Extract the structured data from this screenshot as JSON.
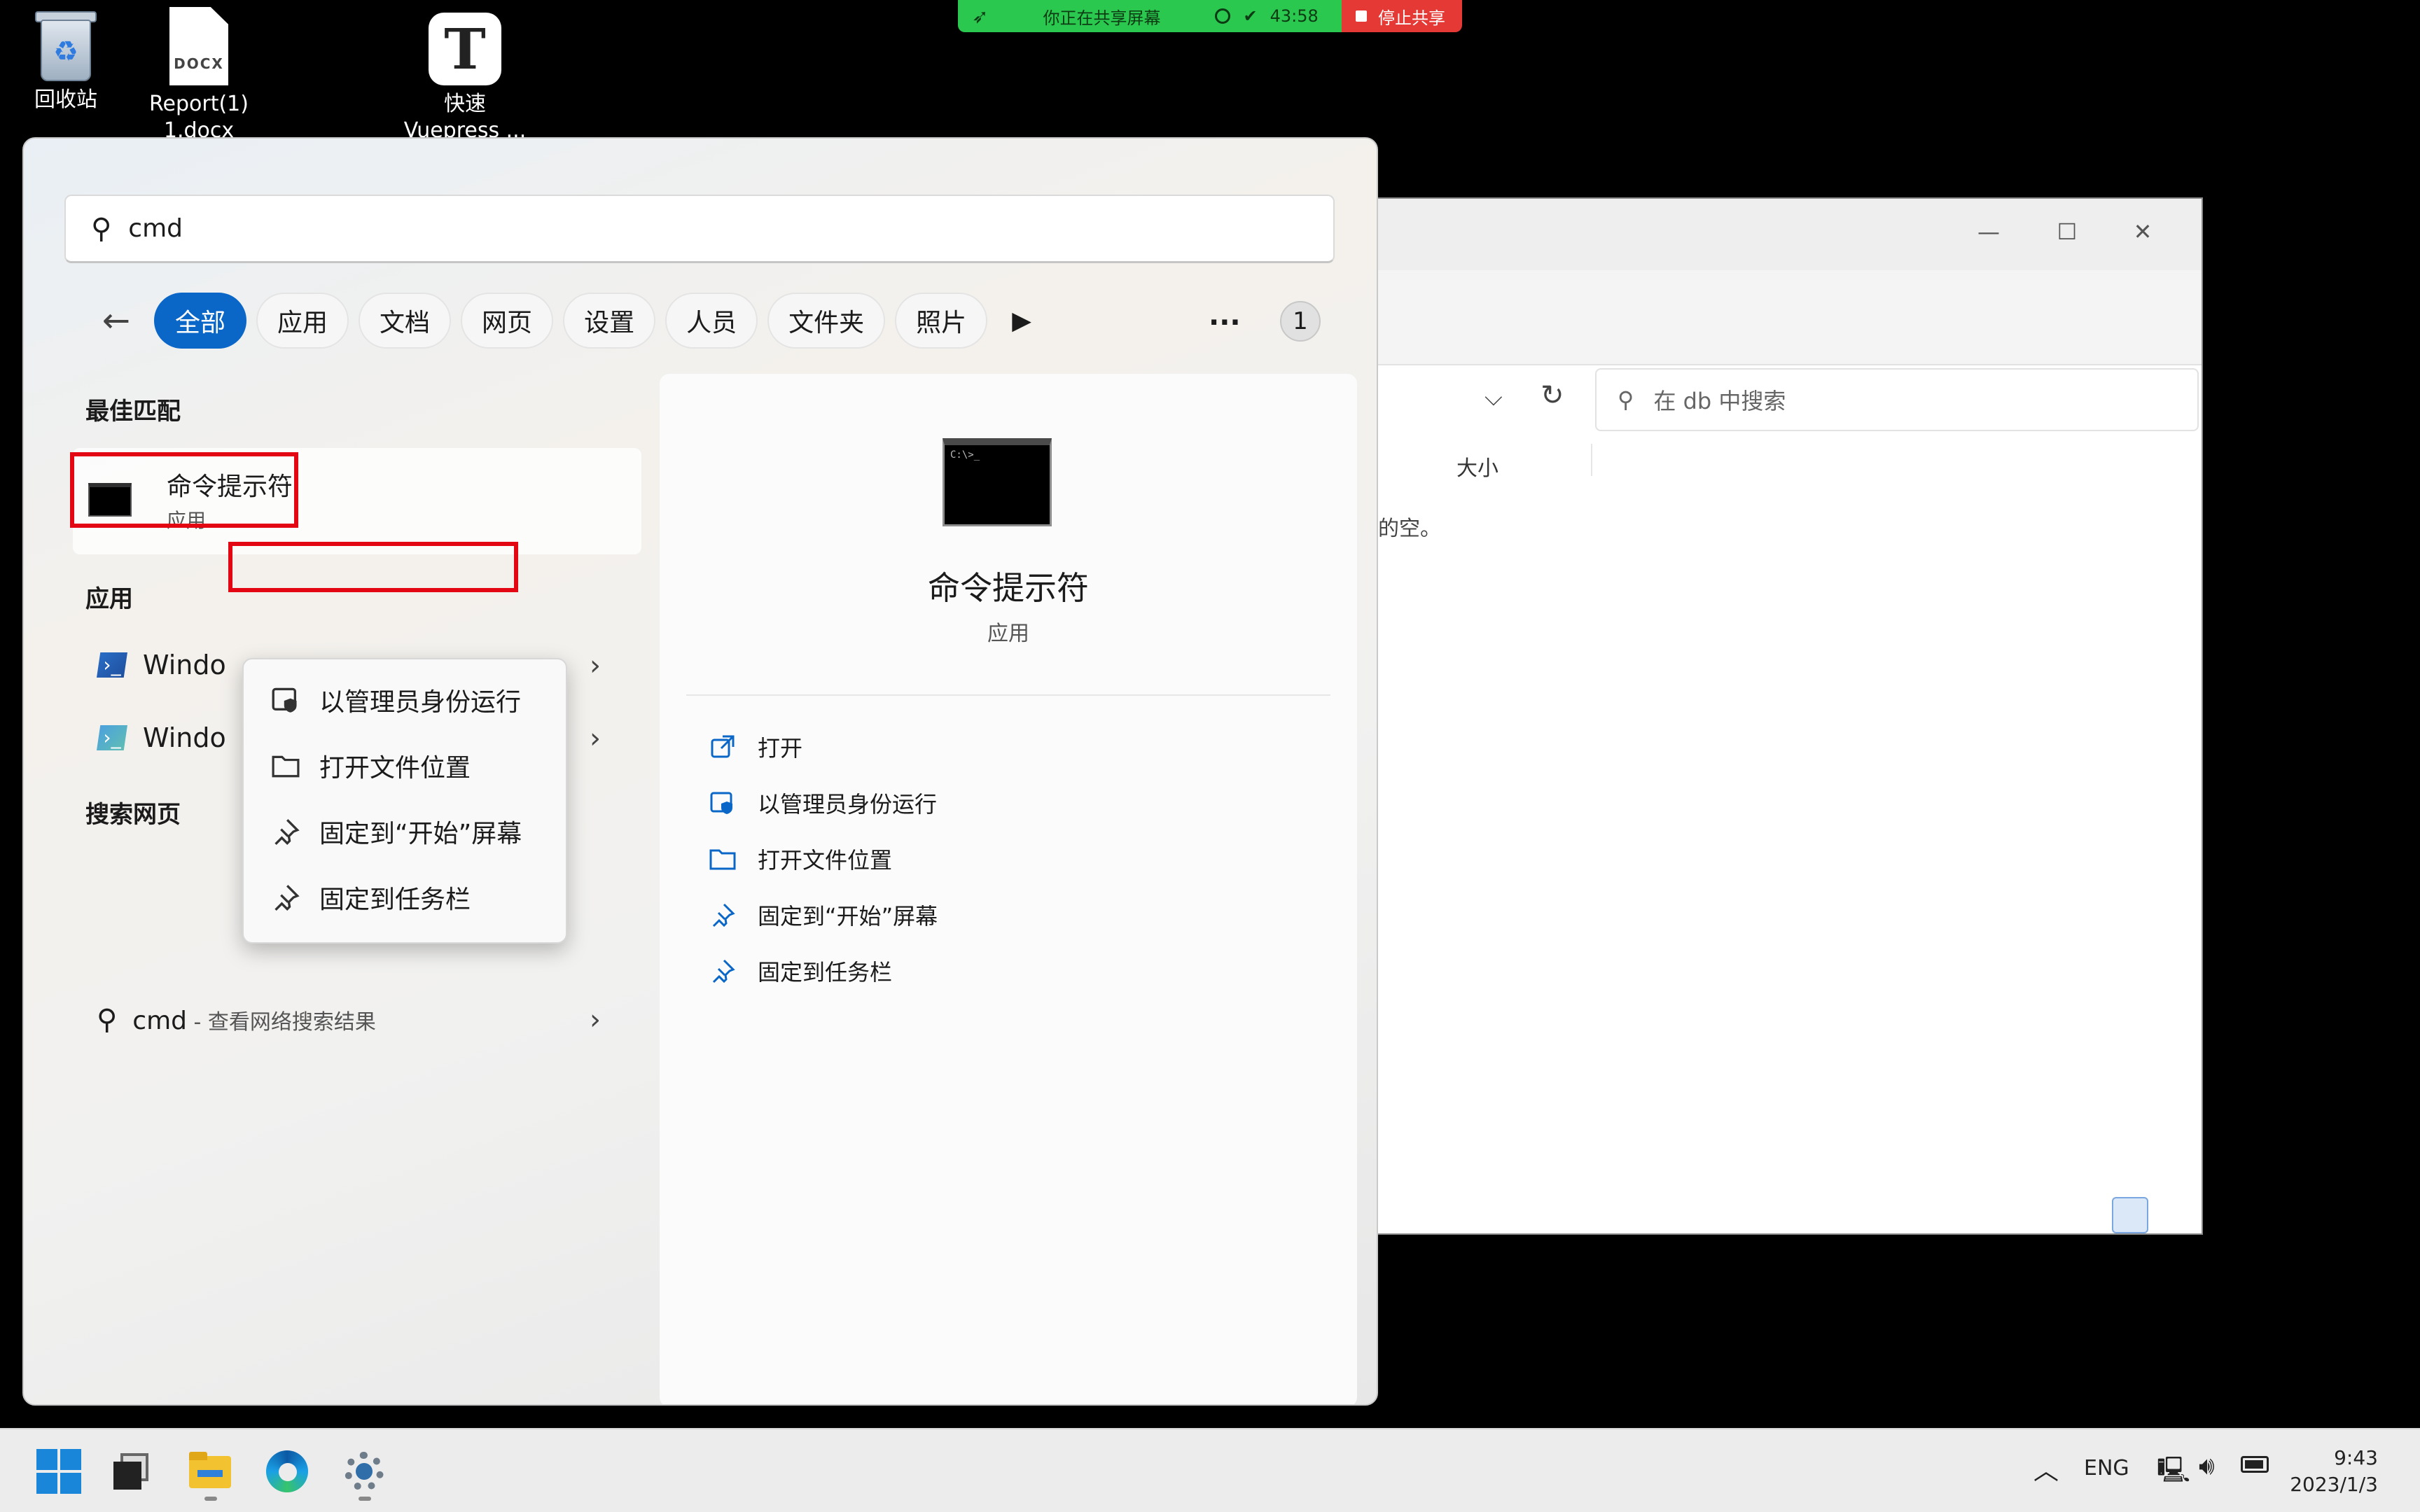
{
  "desktop": {
    "icons": [
      {
        "label": "回收站"
      },
      {
        "label": "Report(1)",
        "label2": "1.docx",
        "ext": "DOCX"
      },
      {
        "label": "快速",
        "label2": "Vuepress ...",
        "glyph": "T"
      }
    ]
  },
  "share_bar": {
    "status": "你正在共享屏幕",
    "timer": "43:58",
    "stop": "停止共享"
  },
  "explorer": {
    "search_placeholder": "在 db 中搜索",
    "column_size": "大小",
    "empty_text": "的空。"
  },
  "start": {
    "search_value": "cmd",
    "filters": [
      "全部",
      "应用",
      "文档",
      "网页",
      "设置",
      "人员",
      "文件夹",
      "照片"
    ],
    "badge": "1",
    "sections": {
      "best": "最佳匹配",
      "apps": "应用",
      "web": "搜索网页"
    },
    "best_match": {
      "name": "命令提示符",
      "sub": "应用"
    },
    "apps": [
      {
        "label": "Windo"
      },
      {
        "label": "Windo"
      }
    ],
    "web_result": {
      "query": "cmd",
      "hint": " - 查看网络搜索结果"
    },
    "context_menu": [
      {
        "label": "以管理员身份运行",
        "icon": "shield-icon"
      },
      {
        "label": "打开文件位置",
        "icon": "folder-icon"
      },
      {
        "label": "固定到“开始”屏幕",
        "icon": "pin-icon"
      },
      {
        "label": "固定到任务栏",
        "icon": "pin-icon"
      }
    ],
    "detail": {
      "title": "命令提示符",
      "subtitle": "应用",
      "actions": [
        {
          "label": "打开",
          "icon": "open-icon"
        },
        {
          "label": "以管理员身份运行",
          "icon": "shield-icon"
        },
        {
          "label": "打开文件位置",
          "icon": "folder-icon"
        },
        {
          "label": "固定到“开始”屏幕",
          "icon": "pin-icon"
        },
        {
          "label": "固定到任务栏",
          "icon": "pin-icon"
        }
      ]
    }
  },
  "taskbar": {
    "lang": "ENG",
    "time": "9:43",
    "date": "2023/1/3"
  },
  "colors": {
    "accent": "#0a67c8",
    "highlight_box": "#e30613",
    "share_green": "#2bc84f",
    "share_red": "#e53935"
  }
}
